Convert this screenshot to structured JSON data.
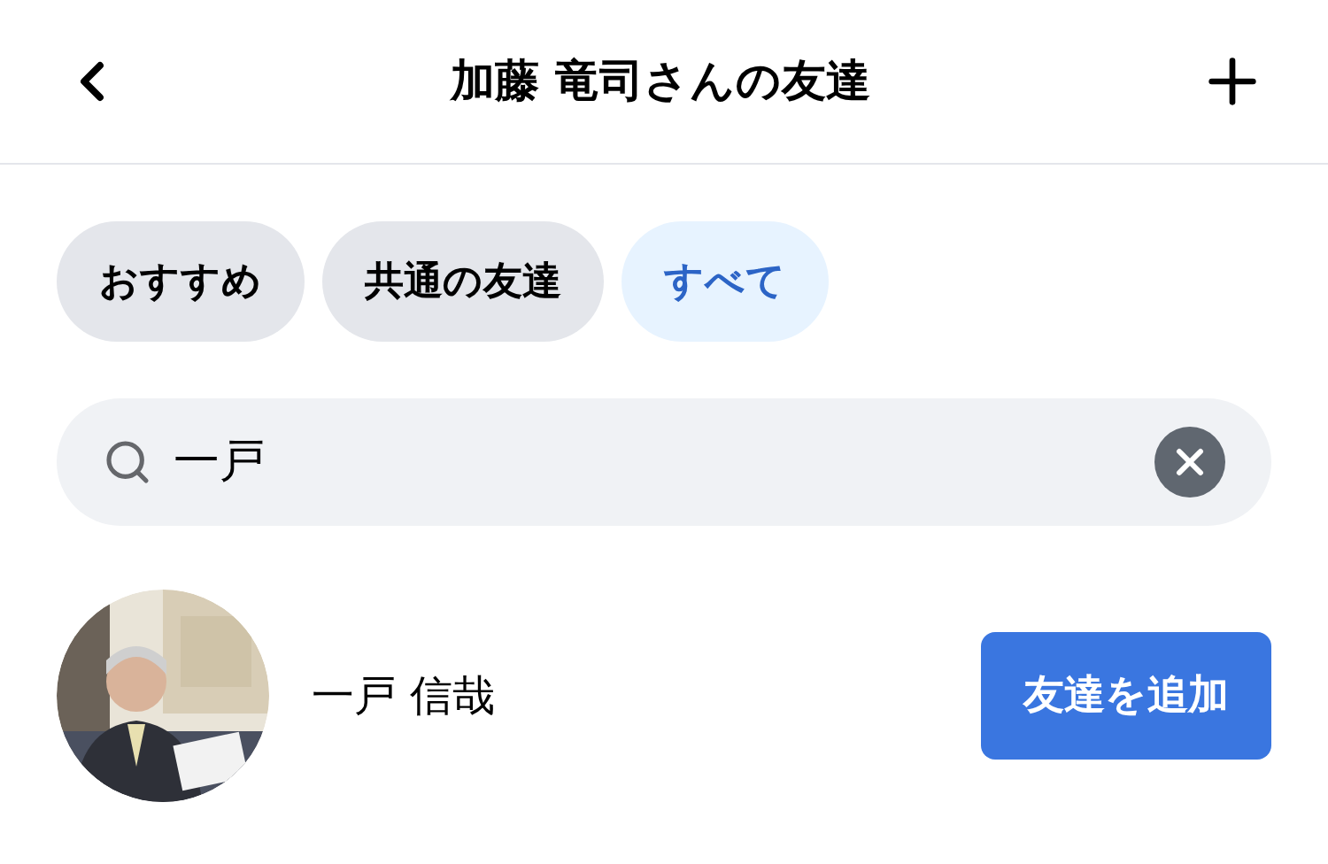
{
  "header": {
    "title": "加藤 竜司さんの友達"
  },
  "filters": [
    {
      "label": "おすすめ",
      "selected": false
    },
    {
      "label": "共通の友達",
      "selected": false
    },
    {
      "label": "すべて",
      "selected": true
    }
  ],
  "search": {
    "value": "一戸"
  },
  "results": [
    {
      "name": "一戸 信哉",
      "action": "友達を追加"
    }
  ]
}
